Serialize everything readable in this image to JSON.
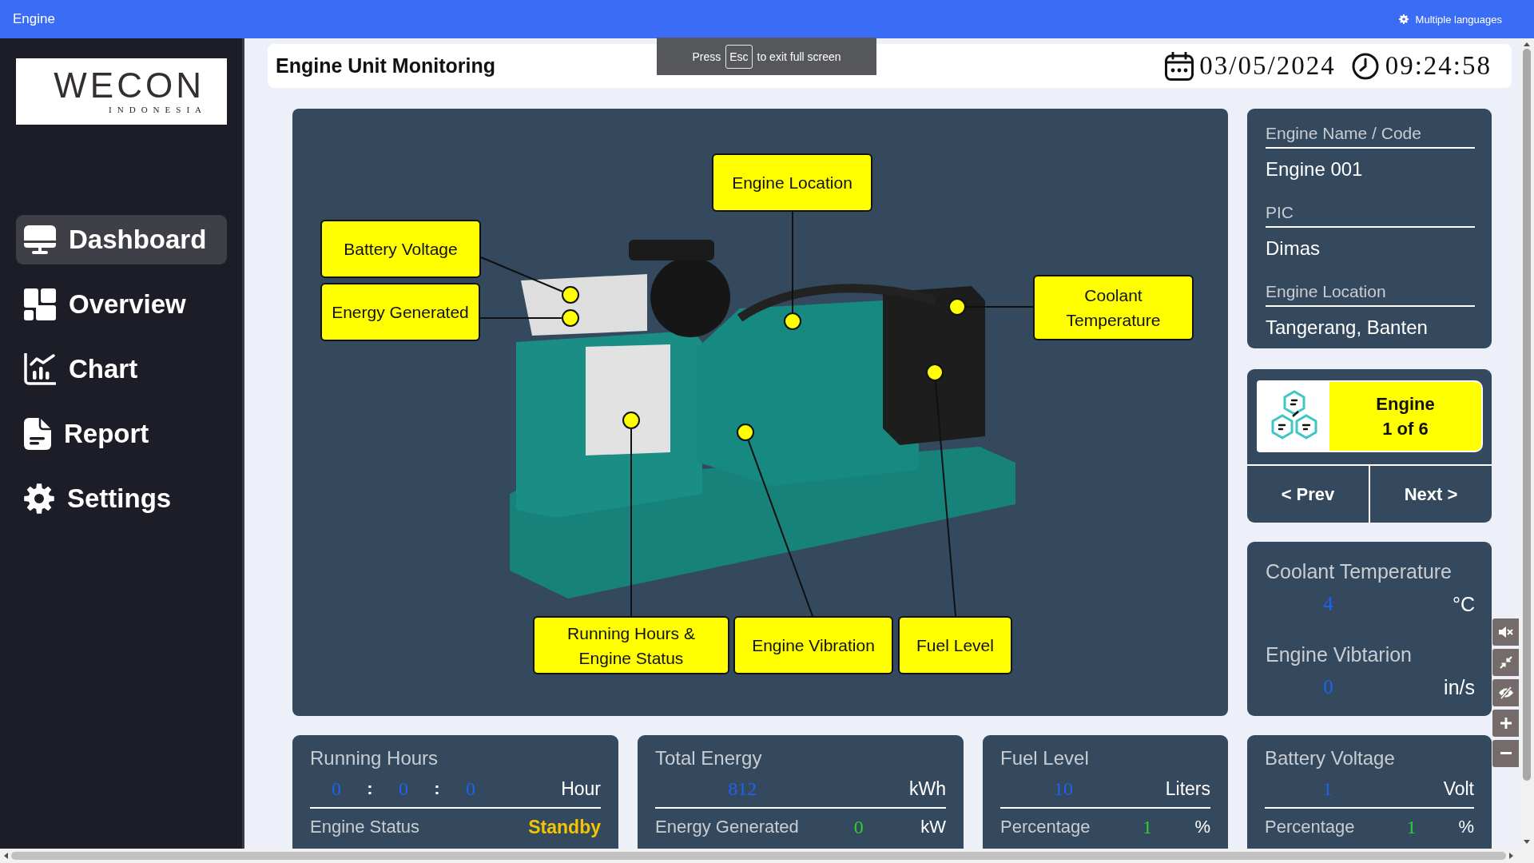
{
  "window": {
    "title": "Engine"
  },
  "top_bar": {
    "language_button": "Multiple languages"
  },
  "fullscreen_notice": {
    "before": "Press",
    "key": "Esc",
    "after": "to exit full screen"
  },
  "sidebar": {
    "logo": {
      "name": "WECON",
      "subtitle": "INDONESIA"
    },
    "items": [
      {
        "label": "Dashboard",
        "selected": true
      },
      {
        "label": "Overview",
        "selected": false
      },
      {
        "label": "Chart",
        "selected": false
      },
      {
        "label": "Report",
        "selected": false
      },
      {
        "label": "Settings",
        "selected": false
      }
    ]
  },
  "header": {
    "title": "Engine Unit Monitoring",
    "date": "03/05/2024",
    "time": "09:24:58"
  },
  "diagram": {
    "callouts": [
      {
        "label": "Engine Location"
      },
      {
        "label": "Battery Voltage"
      },
      {
        "label": "Energy Generated"
      },
      {
        "label": "Coolant Temperature"
      },
      {
        "label": "Running Hours & Engine Status"
      },
      {
        "label": "Engine Vibration"
      },
      {
        "label": "Fuel Level"
      }
    ]
  },
  "engine_info": {
    "fields": [
      {
        "label": "Engine Name / Code",
        "value": "Engine 001"
      },
      {
        "label": "PIC",
        "value": "Dimas"
      },
      {
        "label": "Engine Location",
        "value": "Tangerang, Banten"
      }
    ]
  },
  "engine_selector": {
    "title": "Engine",
    "position": "1 of 6",
    "prev_button": "< Prev",
    "next_button": "Next >"
  },
  "readings": [
    {
      "label": "Coolant Temperature",
      "value": "4",
      "unit": "°C"
    },
    {
      "label": "Engine Vibtarion",
      "value": "0",
      "unit": "in/s"
    }
  ],
  "summary_cards": [
    {
      "title": "Running Hours",
      "parts": [
        {
          "kind": "number",
          "text": "0"
        },
        {
          "kind": "separator",
          "text": ":"
        },
        {
          "kind": "number",
          "text": "0"
        },
        {
          "kind": "separator",
          "text": ":"
        },
        {
          "kind": "number",
          "text": "0"
        }
      ],
      "unit": "Hour",
      "detail": {
        "kind": "status",
        "label": "Engine Status",
        "value": "Standby"
      }
    },
    {
      "title": "Total Energy",
      "parts": [
        {
          "kind": "number",
          "text": "812"
        }
      ],
      "unit": "kWh",
      "detail": {
        "kind": "number",
        "label": "Energy Generated",
        "value": "0",
        "unit": "kW"
      }
    },
    {
      "title": "Fuel Level",
      "parts": [
        {
          "kind": "number",
          "text": "10"
        }
      ],
      "unit": "Liters",
      "detail": {
        "kind": "number",
        "label": "Percentage",
        "value": "1",
        "unit": "%"
      }
    },
    {
      "title": "Battery Voltage",
      "parts": [
        {
          "kind": "number",
          "text": "1"
        }
      ],
      "unit": "Volt",
      "detail": {
        "kind": "number",
        "label": "Percentage",
        "value": "1",
        "unit": "%"
      }
    }
  ]
}
